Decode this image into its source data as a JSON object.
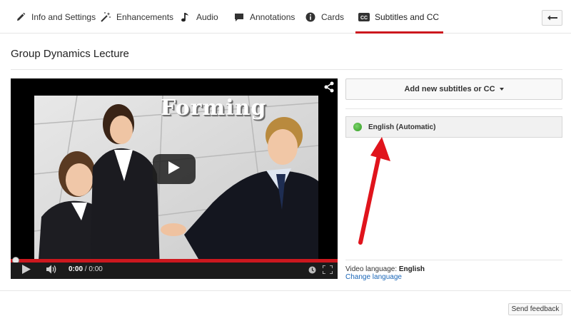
{
  "tabs": [
    {
      "label": "Info and Settings",
      "icon": "pencil-icon"
    },
    {
      "label": "Enhancements",
      "icon": "magic-wand-icon"
    },
    {
      "label": "Audio",
      "icon": "music-note-icon"
    },
    {
      "label": "Annotations",
      "icon": "speech-bubble-icon"
    },
    {
      "label": "Cards",
      "icon": "info-circle-icon"
    },
    {
      "label": "Subtitles and CC",
      "icon": "cc-icon",
      "active": true
    }
  ],
  "page": {
    "title": "Group Dynamics Lecture"
  },
  "video": {
    "caption_text": "Forming",
    "current_time": "0:00",
    "separator": " / ",
    "duration": "0:00",
    "progress": 0.0
  },
  "subtitles": {
    "add_button_label": "Add new subtitles or CC",
    "tracks": [
      {
        "label": "English (Automatic)",
        "status_color": "#3aa52a"
      }
    ],
    "video_language_label": "Video language: ",
    "video_language_value": "English",
    "change_language_label": "Change language"
  },
  "footer": {
    "feedback_label": "Send feedback"
  },
  "colors": {
    "accent": "#cc181e",
    "link": "#1a66b7",
    "annotation_arrow": "#e0141c"
  }
}
